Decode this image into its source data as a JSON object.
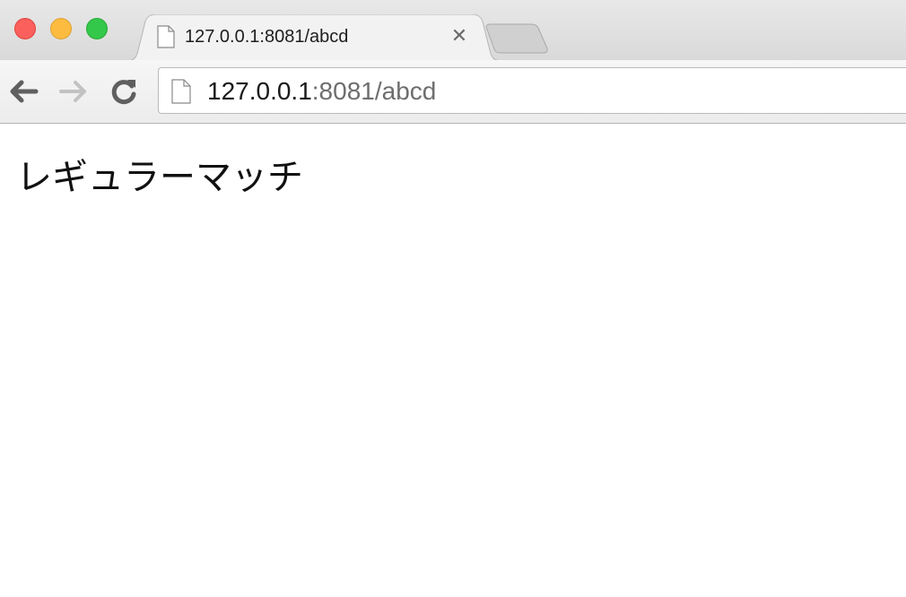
{
  "window": {
    "buttons": {
      "close": "close",
      "minimize": "minimize",
      "zoom": "zoom"
    }
  },
  "tab": {
    "title": "127.0.0.1:8081/abcd",
    "icon": "page-icon",
    "close_icon": "close-icon"
  },
  "new_tab": {
    "icon": "new-tab-icon"
  },
  "toolbar": {
    "back_icon": "back-arrow-icon",
    "forward_icon": "forward-arrow-icon",
    "reload_icon": "reload-icon"
  },
  "omnibox": {
    "url_host": "127.0.0.1",
    "url_rest": ":8081/abcd",
    "icon": "page-icon"
  },
  "page": {
    "text": "レギュラーマッチ"
  },
  "colors": {
    "close": "#fc605c",
    "minimize": "#fdbc40",
    "zoom": "#34c84a"
  }
}
